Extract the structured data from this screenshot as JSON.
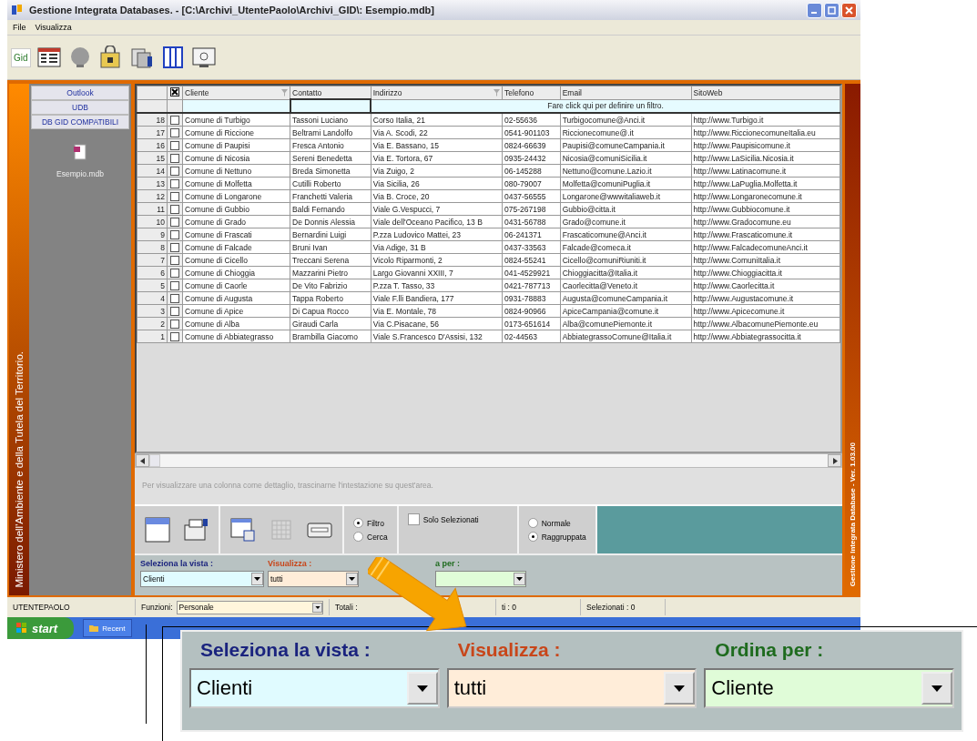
{
  "window": {
    "title": "Gestione Integrata Databases. - [C:\\Archivi_UtentePaolo\\Archivi_GID\\: Esempio.mdb]"
  },
  "menu": [
    "File",
    "Visualizza"
  ],
  "toolbar": {
    "logo": "Gid"
  },
  "sidebar": {
    "banner": "Ministero dell'Ambiente e della Tutela del Territorio.",
    "tabs": [
      "Outlook",
      "UDB",
      "DB GID COMPATIBILI"
    ],
    "files": [
      "Esempio.mdb"
    ]
  },
  "table": {
    "columns": [
      "Cliente",
      "Contatto",
      "Indirizzo",
      "Telefono",
      "Email",
      "SitoWeb"
    ],
    "filter_hint": "Fare click qui per definire un filtro.",
    "rows": [
      {
        "number": "18",
        "checked": false,
        "cells": [
          "Comune di Turbigo",
          "Tassoni Luciano",
          "Corso Italia, 21",
          "02-55636",
          "Turbigocomune@Anci.it",
          "http://www.Turbigo.it"
        ]
      },
      {
        "number": "17",
        "checked": false,
        "cells": [
          "Comune di Riccione",
          "Beltrami Landolfo",
          "Via A. Scodi, 22",
          "0541-901103",
          "Riccionecomune@.it",
          "http://www.RiccionecomuneItalia.eu"
        ]
      },
      {
        "number": "16",
        "checked": false,
        "cells": [
          "Comune di Paupisi",
          "Fresca Antonio",
          "Via E. Bassano, 15",
          "0824-66639",
          "Paupisi@comuneCampania.it",
          "http://www.Paupisicomune.it"
        ]
      },
      {
        "number": "15",
        "checked": false,
        "cells": [
          "Comune di Nicosia",
          "Sereni Benedetta",
          "Via E. Tortora, 67",
          "0935-24432",
          "Nicosia@comuniSicilia.it",
          "http://www.LaSicilia.Nicosia.it"
        ]
      },
      {
        "number": "14",
        "checked": false,
        "cells": [
          "Comune di Nettuno",
          "Breda Simonetta",
          "Via Zuigo, 2",
          "06-145288",
          "Nettuno@comune.Lazio.it",
          "http://www.Latinacomune.it"
        ]
      },
      {
        "number": "13",
        "checked": false,
        "cells": [
          "Comune di Molfetta",
          "Cutilli Roberto",
          "Via Sicilia, 26",
          "080-79007",
          "Molfetta@comuniPuglia.it",
          "http://www.LaPuglia.Molfetta.it"
        ]
      },
      {
        "number": "12",
        "checked": false,
        "cells": [
          "Comune di Longarone",
          "Franchetti Valeria",
          "Via B. Croce, 20",
          "0437-56555",
          "Longarone@wwwitaliaweb.it",
          "http://www.Longaronecomune.it"
        ]
      },
      {
        "number": "11",
        "checked": false,
        "cells": [
          "Comune di Gubbio",
          "Baldi Fernando",
          "Viale G.Vespucci, 7",
          "075-267198",
          "Gubbio@citta.it",
          "http://www.Gubbiocomune.it"
        ]
      },
      {
        "number": "10",
        "checked": false,
        "cells": [
          "Comune di Grado",
          "De Donnis Alessia",
          "Viale dell'Oceano Pacifico, 13 B",
          "0431-56788",
          "Grado@comune.it",
          "http://www.Gradocomune.eu"
        ]
      },
      {
        "number": "9",
        "checked": false,
        "cells": [
          "Comune di Frascati",
          "Bernardini Luigi",
          "P.zza Ludovico Mattei, 23",
          "06-241371",
          "Frascaticomune@Anci.it",
          "http://www.Frascaticomune.it"
        ]
      },
      {
        "number": "8",
        "checked": false,
        "cells": [
          "Comune di Falcade",
          "Bruni Ivan",
          "Via Adige, 31 B",
          "0437-33563",
          "Falcade@comeca.it",
          "http://www.FalcadecomuneAnci.it"
        ]
      },
      {
        "number": "7",
        "checked": false,
        "cells": [
          "Comune di Cicello",
          "Treccani Serena",
          "Vicolo Riparmonti, 2",
          "0824-55241",
          "Cicello@comuniRiuniti.it",
          "http://www.ComuniItalia.it"
        ]
      },
      {
        "number": "6",
        "checked": false,
        "cells": [
          "Comune di Chioggia",
          "Mazzarini Pietro",
          "Largo Giovanni XXIII, 7",
          "041-4529921",
          "Chioggiacitta@Italia.it",
          "http://www.Chioggiacitta.it"
        ]
      },
      {
        "number": "5",
        "checked": false,
        "cells": [
          "Comune di Caorle",
          "De Vito Fabrizio",
          "P.zza T. Tasso, 33",
          "0421-787713",
          "Caorlecitta@Veneto.it",
          "http://www.Caorlecitta.it"
        ]
      },
      {
        "number": "4",
        "checked": false,
        "cells": [
          "Comune di Augusta",
          "Tappa Roberto",
          "Viale F.lli Bandiera, 177",
          "0931-78883",
          "Augusta@comuneCampania.it",
          "http://www.Augustacomune.it"
        ]
      },
      {
        "number": "3",
        "checked": false,
        "cells": [
          "Comune di Apice",
          "Di Capua Rocco",
          "Via E. Montale, 78",
          "0824-90966",
          "ApiceCampania@comune.it",
          "http://www.Apicecomune.it"
        ]
      },
      {
        "number": "2",
        "checked": false,
        "cells": [
          "Comune di Alba",
          "Giraudi Carla",
          "Via C.Pisacane, 56",
          "0173-651614",
          "Alba@comunePiemonte.it",
          "http://www.AlbacomunePiemonte.eu"
        ]
      },
      {
        "number": "1",
        "checked": false,
        "cells": [
          "Comune di Abbiategrasso",
          "Brambilla Giacomo",
          "Viale S.Francesco D'Assisi, 132",
          "02-44563",
          "AbbiategrassoComune@Italia.it",
          "http://www.Abbiategrassocitta.it"
        ]
      }
    ]
  },
  "hint": "Per visualizzare una colonna come dettaglio, trascinarne l'intestazione su quest'area.",
  "options": {
    "mode": [
      {
        "label": "Filtro",
        "selected": true
      },
      {
        "label": "Cerca",
        "selected": false
      }
    ],
    "only_selected": {
      "label": "Solo Selezionati",
      "checked": false
    },
    "layout": [
      {
        "label": "Normale",
        "selected": false
      },
      {
        "label": "Raggruppata",
        "selected": true
      }
    ]
  },
  "selectors": [
    {
      "label": "Seleziona la vista :",
      "color": "#1a237e",
      "value": "Clienti"
    },
    {
      "label": "Visualizza :",
      "color": "#c8461a",
      "value": "tutti"
    },
    {
      "label": "a per :",
      "color": "#1e6b1e"
    }
  ],
  "version": "Gestione Integrata Database - Ver. 1.03.00",
  "status_bar": {
    "user": "UTENTEPAOLO",
    "functions_label": "Funzioni:",
    "functions_value": "Personale",
    "items": [
      "Totali :",
      "ti :  0",
      "Selezionati :  0"
    ]
  },
  "taskbar": {
    "start": "start",
    "tasks": [
      "Recent"
    ]
  },
  "callout": [
    {
      "label": "Seleziona la vista :",
      "color": "#1a237e",
      "value": "Clienti"
    },
    {
      "label": "Visualizza :",
      "color": "#c8461a",
      "value": "tutti"
    },
    {
      "label": "Ordina per :",
      "color": "#1e6b1e",
      "value": "Cliente"
    }
  ]
}
